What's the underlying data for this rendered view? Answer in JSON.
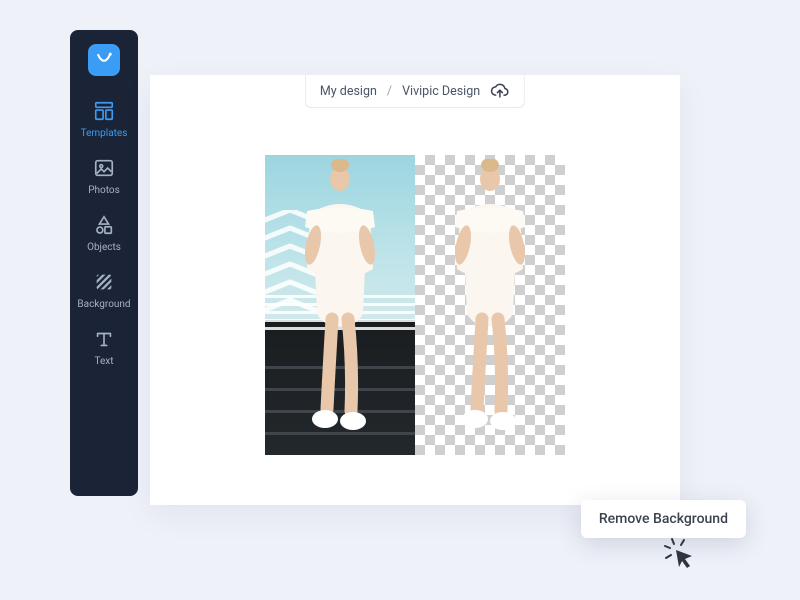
{
  "sidebar": {
    "items": [
      {
        "label": "Templates"
      },
      {
        "label": "Photos"
      },
      {
        "label": "Objects"
      },
      {
        "label": "Background"
      },
      {
        "label": "Text"
      }
    ]
  },
  "breadcrumb": {
    "design_name": "My design",
    "separator": "/",
    "app_name": "Vivipic Design"
  },
  "tooltip": {
    "label": "Remove Background"
  }
}
